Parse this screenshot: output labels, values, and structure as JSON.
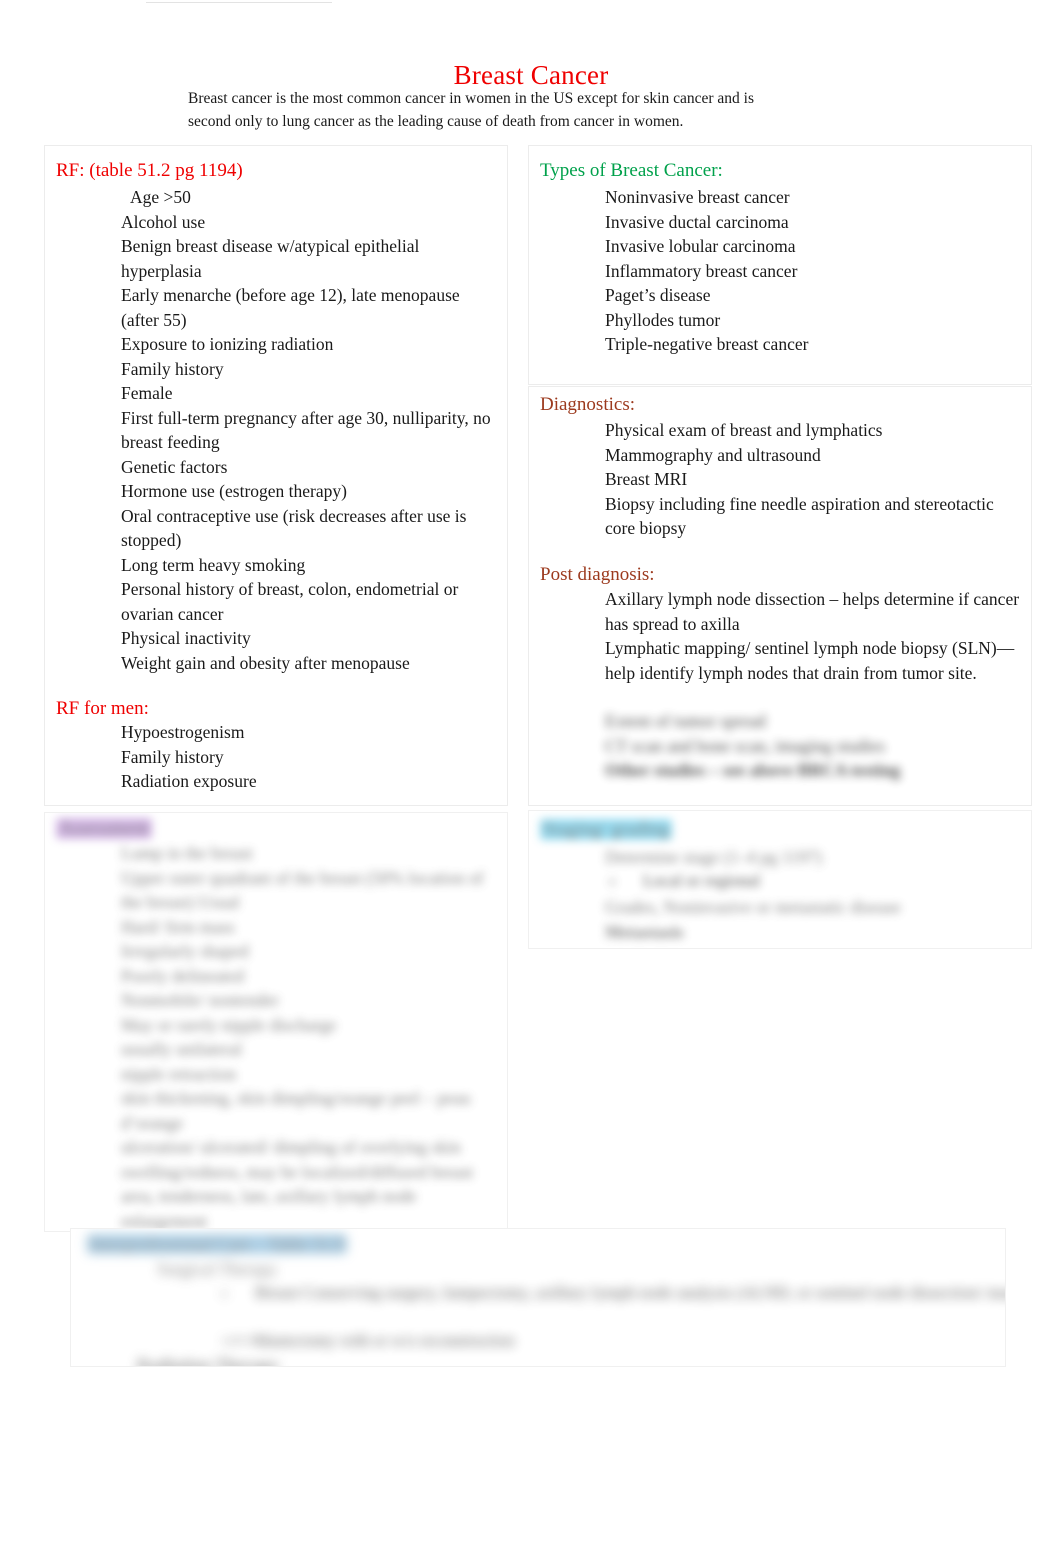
{
  "title": "Breast Cancer",
  "bullet_glyph": "",
  "colors": {
    "title_red": "#ef0000",
    "heading_green": "#00a14b",
    "heading_brown": "#9c3a1e",
    "highlight_purple": "#c8a2e0",
    "highlight_cyan": "#79d4f0",
    "highlight_blue": "#8fc0e0",
    "panel_border": "#ececec"
  },
  "intro": {
    "text": "Breast cancer is the most common cancer in women in the US except for skin cancer and is second only to lung cancer as the leading cause of death from cancer in women."
  },
  "risk_factors": {
    "heading": "RF: (table 51.2 pg 1194)",
    "items": [
      "Age >50",
      "Alcohol use",
      "Benign breast disease w/atypical epithelial hyperplasia",
      "Early menarche (before age 12), late menopause (after 55)",
      "Exposure to ionizing radiation",
      "Family history",
      "Female",
      "First full-term pregnancy after age 30, nulliparity, no breast feeding",
      "Genetic factors",
      "Hormone use (estrogen therapy)",
      "Oral contraceptive use (risk decreases after use is stopped)",
      "Long term heavy smoking",
      "Personal history of breast, colon, endometrial or ovarian cancer",
      "Physical inactivity",
      "Weight gain and obesity after menopause"
    ]
  },
  "risk_factors_men": {
    "heading": "RF for men:",
    "items": [
      "Hypoestrogenism",
      "Family history",
      "Radiation exposure"
    ]
  },
  "types": {
    "heading": "Types of Breast Cancer:",
    "items": [
      "Noninvasive breast cancer",
      "Invasive ductal carcinoma",
      "Invasive lobular carcinoma",
      "Inflammatory breast cancer",
      "Paget’s disease",
      "Phyllodes tumor",
      "Triple-negative breast cancer"
    ]
  },
  "diagnostics": {
    "heading": "Diagnostics:",
    "items": [
      "Physical exam of breast and lymphatics",
      "Mammography and ultrasound",
      "Breast MRI",
      "Biopsy including fine needle aspiration and stereotactic core biopsy"
    ]
  },
  "post_diagnosis": {
    "heading": "Post diagnosis:",
    "items": [
      "Axillary lymph node dissection – helps determine if cancer has spread to axilla",
      "Lymphatic mapping/ sentinel lymph node biopsy (SLN)—help identify lymph nodes that drain from tumor site.",
      "Extent of tumor spread",
      "CT scan and bone scan, imaging studies",
      "Other studies – see above BRCA testing"
    ]
  },
  "staging": {
    "heading": "Staging/ grading",
    "items": [
      "Determine stage (1–4 pg 1197)",
      "Local or regional",
      "Grades, Noninvasive or metastatic disease",
      "Metastasis"
    ]
  },
  "assessment": {
    "heading": "Assessment",
    "items": [
      "Lump in the breast",
      "Upper outer quadrant of the breast (50% location of the breast) Usual",
      "Hard/ firm mass",
      "Irregularly shaped",
      "Poorly delineated",
      "Nonmobile/ nontender",
      "May or rarely nipple discharge",
      "usually unilateral",
      "nipple retraction",
      "skin thickening, skin dimpling/orange peel – peau d’orange",
      "ulceration/ ulcerated/ dimpling of overlying skin",
      "swelling/redness, may be localized/diffused breast area, tenderness, late, axillary lymph node enlargement"
    ]
  },
  "therapy": {
    "heading": "Interprofessional Care – Table 51.9",
    "items": [
      "Surgical Therapy",
      "Breast Conserving surgery, lumpectomy, axillary lymph node analysis (ALND, or sentinel node dissection/ mastectomy)",
      "Mastectomy with or w/o reconstruction",
      "Radiation Therapy"
    ]
  }
}
